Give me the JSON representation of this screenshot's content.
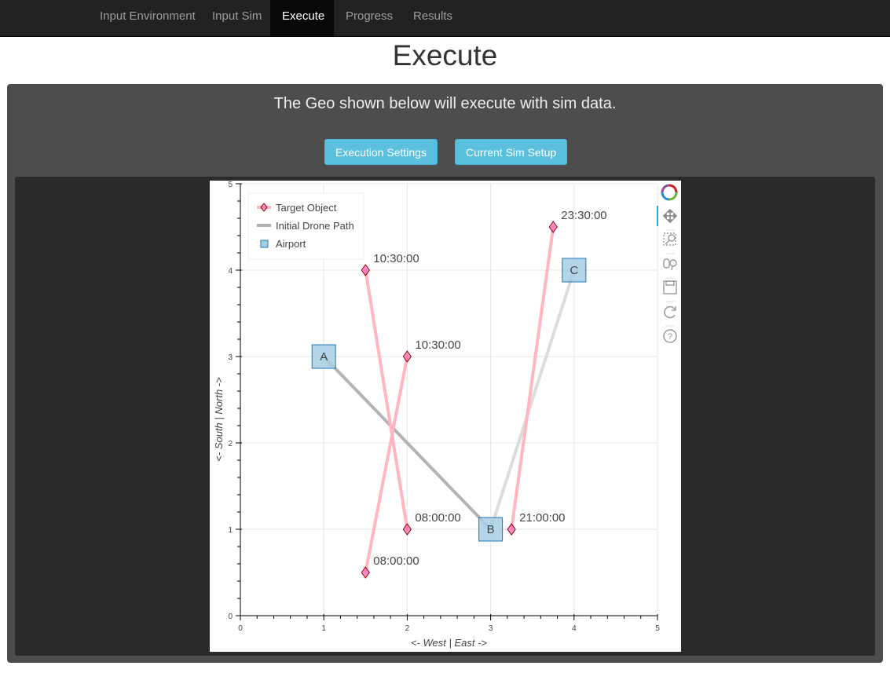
{
  "nav": {
    "items": [
      {
        "label": "Input Environment",
        "active": false
      },
      {
        "label": "Input Sim",
        "active": false
      },
      {
        "label": "Execute",
        "active": true
      },
      {
        "label": "Progress",
        "active": false
      },
      {
        "label": "Results",
        "active": false
      }
    ]
  },
  "page": {
    "title": "Execute",
    "subtitle": "The Geo shown below will execute with sim data."
  },
  "buttons": {
    "execution_settings": "Execution Settings",
    "current_sim_setup": "Current Sim Setup"
  },
  "toolbar": {
    "tools": [
      "bokeh-logo-icon",
      "pan-icon",
      "box-zoom-icon",
      "wheel-zoom-icon",
      "save-icon",
      "reset-icon",
      "help-icon"
    ]
  },
  "chart_data": {
    "type": "scatter",
    "xlabel": "<- West  |  East ->",
    "ylabel": "<- South  |  North ->",
    "xlim": [
      0,
      5
    ],
    "ylim": [
      0,
      5
    ],
    "xticks": [
      "0",
      "1",
      "2",
      "3",
      "4",
      "5"
    ],
    "yticks": [
      "0",
      "1",
      "2",
      "3",
      "4",
      "5"
    ],
    "grid": true,
    "legend_position": "top-left",
    "legend": [
      {
        "label": "Target Object",
        "marker": "diamond-line",
        "color": "#ff69b4"
      },
      {
        "label": "Initial Drone Path",
        "marker": "line",
        "color": "#b0b0b0"
      },
      {
        "label": "Airport",
        "marker": "square",
        "color": "#a6cee3"
      }
    ],
    "airports": [
      {
        "name": "A",
        "x": 1,
        "y": 3
      },
      {
        "name": "B",
        "x": 3,
        "y": 1
      },
      {
        "name": "C",
        "x": 4,
        "y": 4
      }
    ],
    "drone_path": [
      {
        "from": [
          1,
          3
        ],
        "to": [
          3,
          1
        ],
        "color": "#b3b3b3"
      },
      {
        "from": [
          3,
          1
        ],
        "to": [
          4,
          4
        ],
        "color": "#dcdcdc"
      }
    ],
    "targets": [
      {
        "points": [
          {
            "x": 2,
            "y": 1,
            "label": "08:00:00"
          },
          {
            "x": 1.5,
            "y": 4,
            "label": "10:30:00"
          }
        ]
      },
      {
        "points": [
          {
            "x": 1.5,
            "y": 0.5,
            "label": "08:00:00"
          },
          {
            "x": 2,
            "y": 3,
            "label": "10:30:00"
          }
        ]
      },
      {
        "points": [
          {
            "x": 3.25,
            "y": 1,
            "label": "21:00:00"
          },
          {
            "x": 3.75,
            "y": 4.5,
            "label": "23:30:00"
          }
        ]
      }
    ],
    "colors": {
      "target_line": "#ffb6c1",
      "target_marker_fill": "#ff69b4",
      "target_marker_stroke": "#8b0000",
      "airport_fill": "#a6cee3",
      "airport_stroke": "#1f78b4"
    }
  }
}
